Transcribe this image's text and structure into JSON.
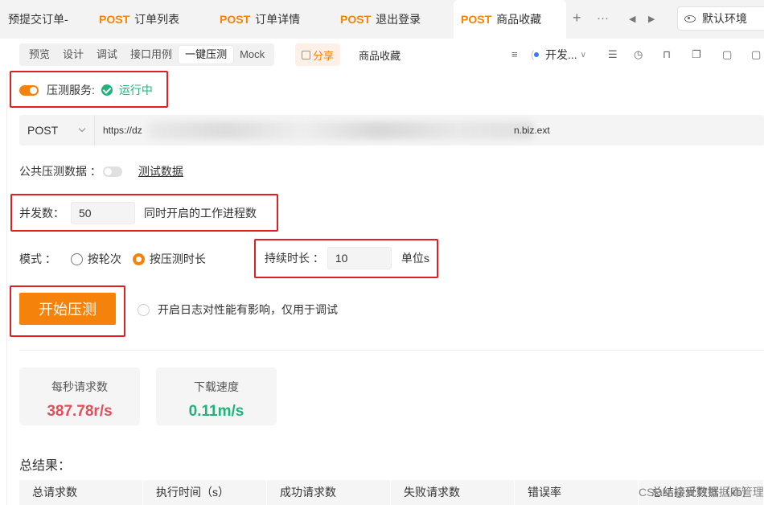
{
  "tabs": [
    {
      "method": "",
      "label": "预提交订单-",
      "active": false
    },
    {
      "method": "POST",
      "label": "订单列表",
      "active": false
    },
    {
      "method": "POST",
      "label": "订单详情",
      "active": false
    },
    {
      "method": "POST",
      "label": "退出登录",
      "active": false
    },
    {
      "method": "POST",
      "label": "商品收藏",
      "active": true
    }
  ],
  "tab_controls": {
    "add": "+",
    "more": "···",
    "prev": "◀",
    "next": "▶"
  },
  "environment": {
    "label": "默认环境"
  },
  "subtabs": [
    "预览",
    "设计",
    "调试",
    "接口用例",
    "一键压测",
    "Mock"
  ],
  "share_label": "分享",
  "api_name": "商品收藏",
  "dev_status": "开发...",
  "service": {
    "label": "压测服务:",
    "status": "运行中"
  },
  "request": {
    "method": "POST",
    "url_prefix": "https://dz",
    "url_suffix": "n.biz.ext"
  },
  "public_data": {
    "label": "公共压测数据 ：",
    "link": "测试数据"
  },
  "concurrency": {
    "label": "并发数：",
    "value": "50",
    "hint": "同时开启的工作进程数"
  },
  "mode": {
    "label": "模式 ：",
    "options": [
      "按轮次",
      "按压测时长"
    ],
    "selected": "按压测时长"
  },
  "duration": {
    "label": "持续时长 ：",
    "value": "10",
    "unit": "单位s"
  },
  "start_button": "开始压测",
  "log_option": "开启日志对性能有影响，仅用于调试",
  "stats": [
    {
      "label": "每秒请求数",
      "value": "387.78r/s",
      "color": "#e0505a"
    },
    {
      "label": "下载速度",
      "value": "0.11m/s",
      "color": "#20b37a"
    }
  ],
  "summary": {
    "title": "总结果：",
    "columns": [
      "总请求数",
      "执行时间（s）",
      "成功请求数",
      "失败请求数",
      "错误率",
      "总结接受数据（kb）"
    ]
  },
  "watermark": "CSDN @玩转数据库管理工具",
  "colors": {
    "accent": "#f5820b",
    "success": "#20b37a",
    "danger": "#e0505a",
    "annotation": "#e02020"
  }
}
